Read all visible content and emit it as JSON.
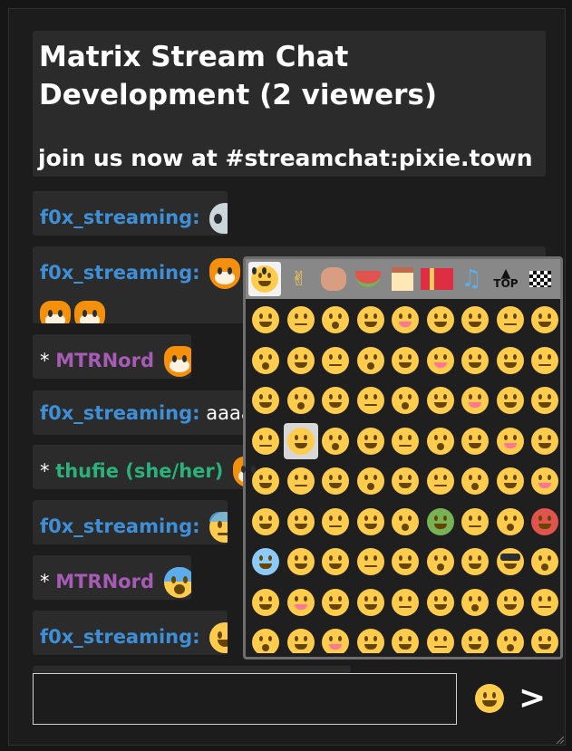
{
  "header": {
    "title": "Matrix Stream Chat Development (2 viewers)",
    "subtitle": "join us now at #streamchat:pixie.town"
  },
  "messages": [
    {
      "prefix": "",
      "user": "f0x_streaming:",
      "text": "",
      "emoji": "alien"
    },
    {
      "prefix": "",
      "user": "f0x_streaming:",
      "text": "",
      "emoji": "fox x4"
    },
    {
      "prefix": "* ",
      "user": "MTRNord",
      "text": "",
      "emoji": "fox"
    },
    {
      "prefix": "",
      "user": "f0x_streaming:",
      "text": "aaaaa",
      "emoji": ""
    },
    {
      "prefix": "* ",
      "user": "thufie (she/her)",
      "text": "",
      "emoji": "fox"
    },
    {
      "prefix": "",
      "user": "f0x_streaming:",
      "text": "",
      "emoji": "anxious-face-with-sweat"
    },
    {
      "prefix": "* ",
      "user": "MTRNord",
      "text": "",
      "emoji": "face-screaming-in-fear"
    },
    {
      "prefix": "",
      "user": "f0x_streaming:",
      "text": "",
      "emoji": "grinning-face"
    }
  ],
  "emoji_picker": {
    "tabs": [
      "smileys",
      "people",
      "animals",
      "food",
      "places",
      "objects",
      "symbols",
      "top",
      "flags"
    ],
    "top_tab_label": "TOP",
    "active_tab": "smileys",
    "selected_emoji": "smiling-face-with-open-hands"
  },
  "composer": {
    "placeholder": "",
    "send_label": ">"
  },
  "colors": {
    "username_blue": "#3e8fd6",
    "username_purple": "#a65bb5",
    "username_green": "#2bb17b"
  }
}
